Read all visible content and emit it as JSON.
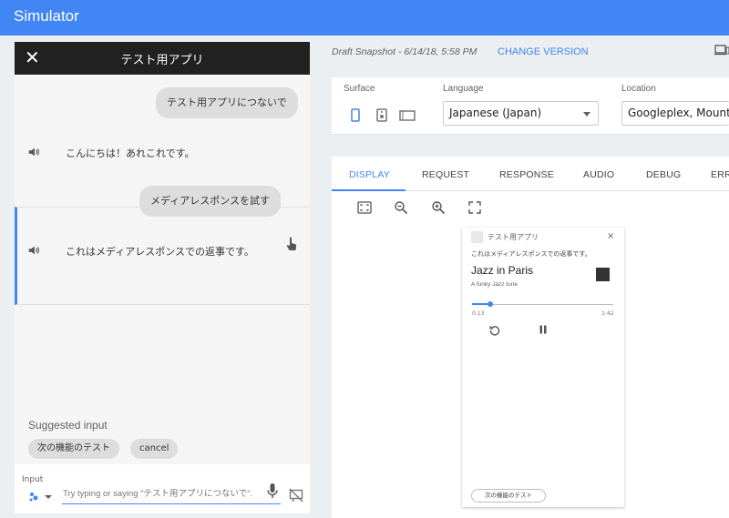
{
  "app": {
    "title": "Simulator"
  },
  "chat_panel": {
    "title": "テスト用アプリ",
    "close_glyph": "✕",
    "messages": [
      {
        "role": "user",
        "text": "テスト用アプリにつないで"
      },
      {
        "role": "assistant",
        "text": "こんにちは！あれこれです。"
      },
      {
        "role": "user",
        "text": "メディアレスポンスを試す"
      },
      {
        "role": "assistant",
        "text": "これはメディアレスポンスでの返事です。"
      }
    ],
    "suggested_label": "Suggested input",
    "suggestions": [
      "次の機能のテスト",
      "cancel"
    ],
    "input_label": "Input",
    "input_placeholder": "Try typing or saying \"テスト用アプリにつないで\"."
  },
  "header": {
    "draft": "Draft Snapshot - 6/14/18, 5:58 PM",
    "change_version": "CHANGE VERSION"
  },
  "settings": {
    "surface_label": "Surface",
    "language_label": "Language",
    "language_value": "Japanese (Japan)",
    "location_label": "Location",
    "location_value": "Googleplex, Mountai"
  },
  "tabs": [
    "DISPLAY",
    "REQUEST",
    "RESPONSE",
    "AUDIO",
    "DEBUG",
    "ERR"
  ],
  "active_tab": "DISPLAY",
  "device": {
    "app_name": "テスト用アプリ",
    "close_glyph": "×",
    "message": "これはメディアレスポンスでの返事です。",
    "media": {
      "title": "Jazz in Paris",
      "description": "A funky Jazz tune",
      "elapsed": "0:13",
      "duration": "1:42",
      "progress": 0.13
    },
    "suggestion_chip": "次の機能のテスト"
  },
  "colors": {
    "accent": "#4285f4",
    "header_dark": "#212121"
  }
}
